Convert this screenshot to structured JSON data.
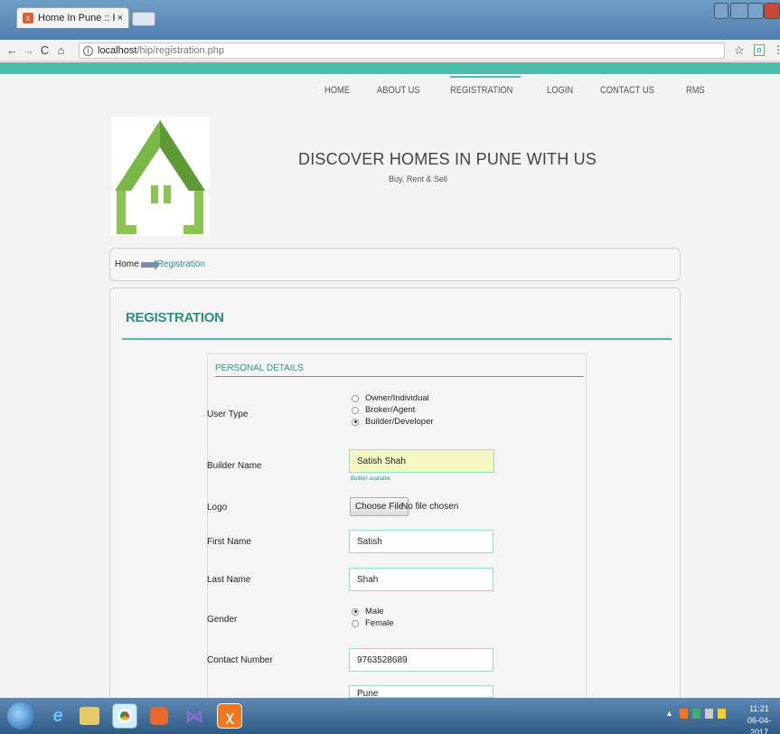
{
  "browser": {
    "tab_title": "Home In Pune :: Registra",
    "tab_close": "×",
    "tab_favicon": "x",
    "url_host": "localhost",
    "url_path": "/hip/registration.php",
    "info_glyph": "i",
    "star_glyph": "☆",
    "menu_glyph": "⋮",
    "ext_glyph": "o",
    "nav": {
      "back": "←",
      "forward": "→",
      "reload": "C",
      "home": "⌂"
    }
  },
  "site": {
    "nav": [
      "HOME",
      "ABOUT US",
      "REGISTRATION",
      "LOGIN",
      "CONTACT US",
      "RMS"
    ],
    "headline": "DISCOVER HOMES IN PUNE WITH US",
    "tagline": "Buy, Rent & Sell",
    "colors": {
      "accent": "#4dbba7",
      "logo_green": "#7ab648",
      "heading": "#2b8f80"
    }
  },
  "breadcrumb": {
    "home": "Home",
    "current": "Registration"
  },
  "registration": {
    "title": "REGISTRATION",
    "section_title": "PERSONAL DETAILS",
    "user_type": {
      "label": "User Type",
      "options": [
        "Owner/Individual",
        "Broker/Agent",
        "Builder/Developer"
      ],
      "selected": "Builder/Developer"
    },
    "builder_name": {
      "label": "Builder Name",
      "value": "Satish Shah",
      "hint": "Builder available"
    },
    "logo": {
      "label": "Logo",
      "button": "Choose File",
      "status": "No file chosen"
    },
    "first_name": {
      "label": "First Name",
      "value": "Satish"
    },
    "last_name": {
      "label": "Last Name",
      "value": "Shah"
    },
    "gender": {
      "label": "Gender",
      "options": [
        "Male",
        "Female"
      ],
      "selected": "Male"
    },
    "contact_number": {
      "label": "Contact Number",
      "value": "9763528689"
    },
    "city": {
      "value": "Pune"
    }
  },
  "taskbar": {
    "clock_time": "11:21",
    "clock_date": "06-04-2017",
    "xampp_glyph": "ꭓ"
  }
}
